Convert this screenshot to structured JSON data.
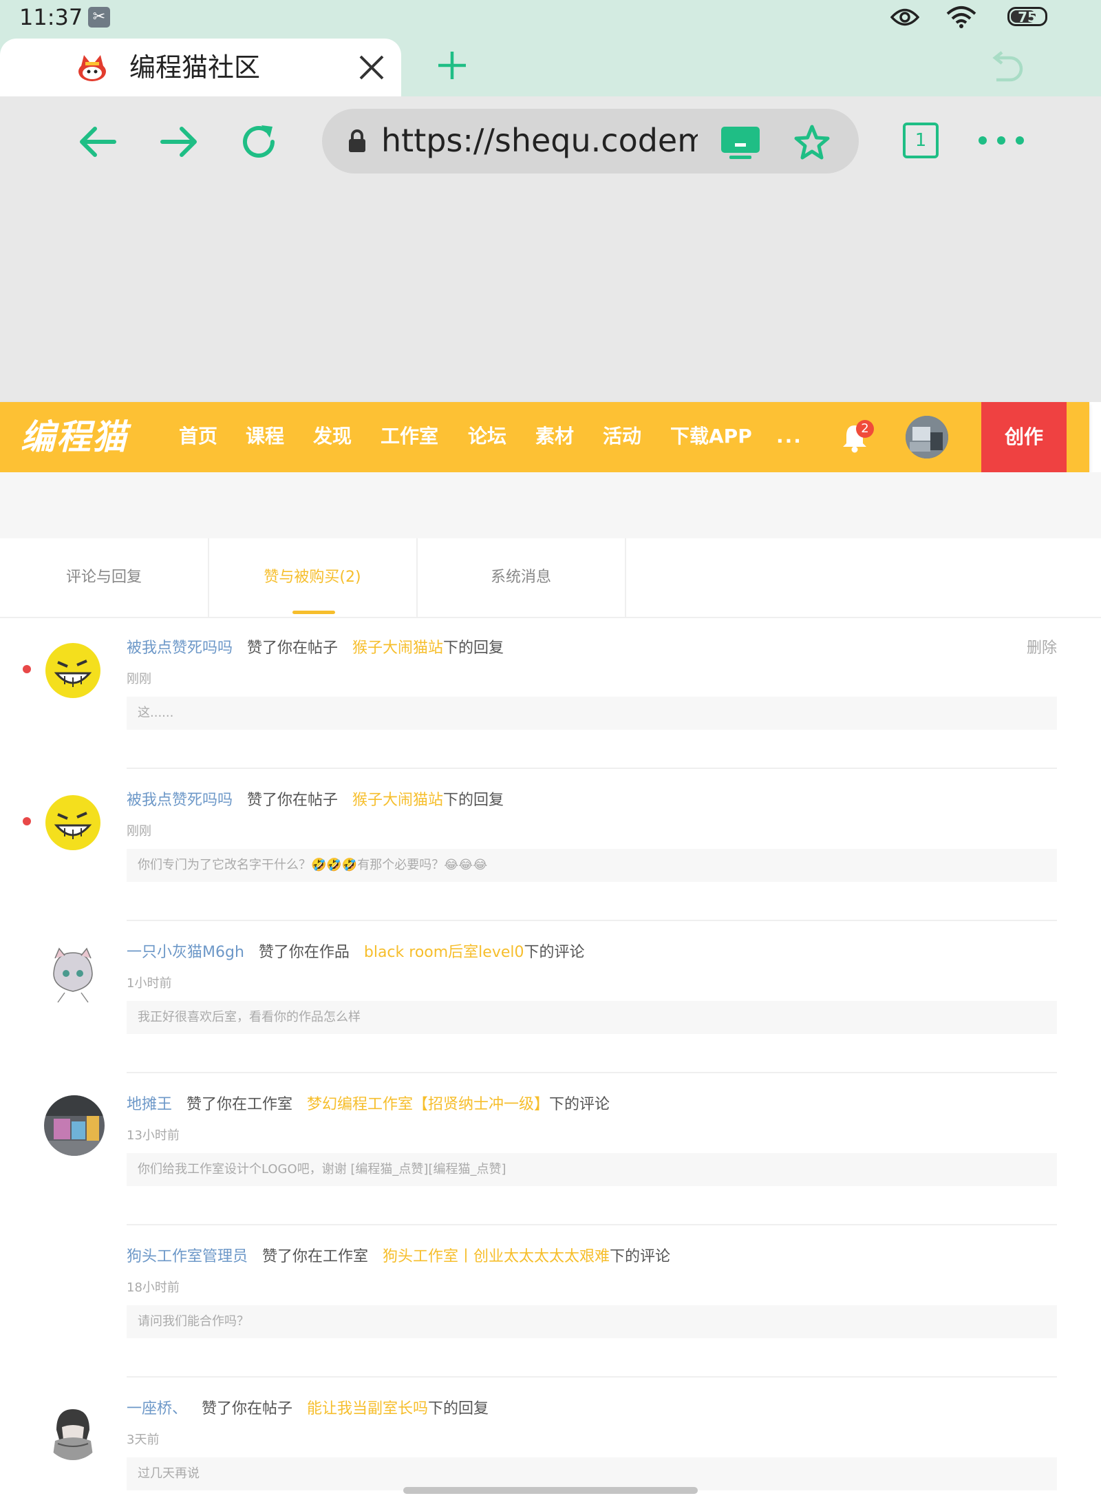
{
  "status_bar": {
    "time": "11:37",
    "battery": "75",
    "battery_level": 0.75
  },
  "browser": {
    "tab_title": "编程猫社区",
    "url": "https://shequ.codem...",
    "tab_count": "1"
  },
  "site_nav": {
    "logo": "编程猫",
    "items": [
      "首页",
      "课程",
      "发现",
      "工作室",
      "论坛",
      "素材",
      "活动",
      "下载APP"
    ],
    "more": "···",
    "notification_count": "2",
    "create_label": "创作"
  },
  "message_tabs": [
    {
      "label": "评论与回复",
      "active": false
    },
    {
      "label": "赞与被购买(2)",
      "active": true
    },
    {
      "label": "系统消息",
      "active": false
    }
  ],
  "messages": [
    {
      "user": "被我点赞死吗吗",
      "action": "赞了你在帖子",
      "target": "猴子大闹猫站",
      "suffix": "下的回复",
      "time": "刚刚",
      "quote": "这......",
      "unread": true,
      "delete_label": "删除"
    },
    {
      "user": "被我点赞死吗吗",
      "action": "赞了你在帖子",
      "target": "猴子大闹猫站",
      "suffix": "下的回复",
      "time": "刚刚",
      "quote": "你们专门为了它改名字干什么？🤣🤣🤣有那个必要吗？😂😂😂",
      "unread": true,
      "delete_label": ""
    },
    {
      "user": "一只小灰猫M6gh",
      "action": "赞了你在作品",
      "target": "black room后室level0",
      "suffix": "下的评论",
      "time": "1小时前",
      "quote": "我正好很喜欢后室，看看你的作品怎么样",
      "unread": false,
      "delete_label": ""
    },
    {
      "user": "地摊王",
      "action": "赞了你在工作室",
      "target": "梦幻编程工作室【招贤纳士冲一级】",
      "suffix": "下的评论",
      "time": "13小时前",
      "quote": "你们给我工作室设计个LOGO吧，谢谢 [编程猫_点赞][编程猫_点赞]",
      "unread": false,
      "delete_label": ""
    },
    {
      "user": "狗头工作室管理员",
      "action": "赞了你在工作室",
      "target": "狗头工作室丨创业太太太太太艰难",
      "suffix": "下的评论",
      "time": "18小时前",
      "quote": "请问我们能合作吗？",
      "unread": false,
      "delete_label": ""
    },
    {
      "user": "一座桥、",
      "action": "赞了你在帖子",
      "target": "能让我当副室长吗",
      "suffix": "下的回复",
      "time": "3天前",
      "quote": "过几天再说",
      "unread": false,
      "delete_label": ""
    }
  ],
  "colors": {
    "nav_yellow": "#fdc134",
    "create_red": "#ef4141",
    "browser_green": "#1fbe85",
    "user_blue": "#6d98c8",
    "target_yellow": "#f6be2c"
  }
}
